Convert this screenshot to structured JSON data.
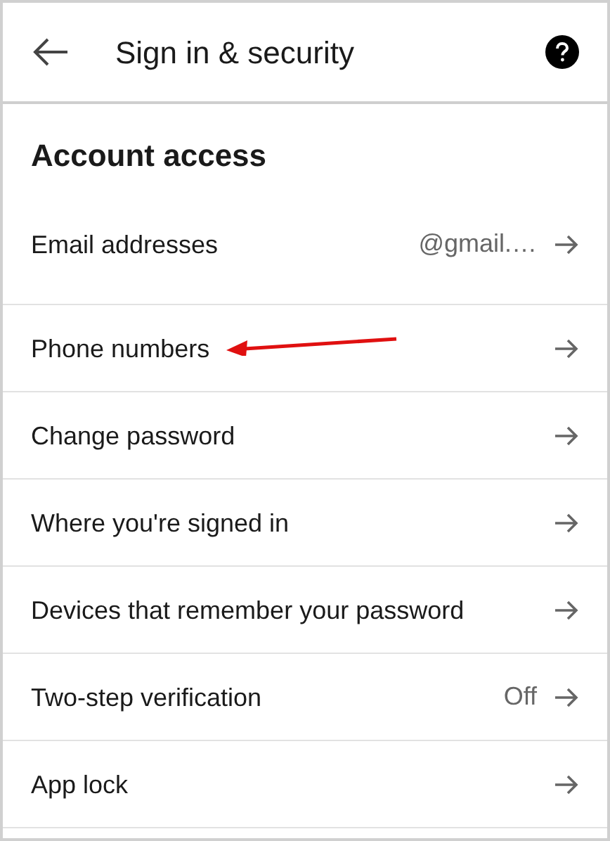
{
  "header": {
    "title": "Sign in & security"
  },
  "section": {
    "title": "Account access"
  },
  "rows": [
    {
      "label": "Email addresses",
      "value": "@gmail.…",
      "annotated": false
    },
    {
      "label": "Phone numbers",
      "annotated": true
    },
    {
      "label": "Change password",
      "annotated": false
    },
    {
      "label": "Where you're signed in",
      "annotated": false
    },
    {
      "label": "Devices that remember your password",
      "annotated": false
    },
    {
      "label": "Two-step verification",
      "value": "Off",
      "annotated": false
    },
    {
      "label": "App lock",
      "annotated": false
    }
  ]
}
